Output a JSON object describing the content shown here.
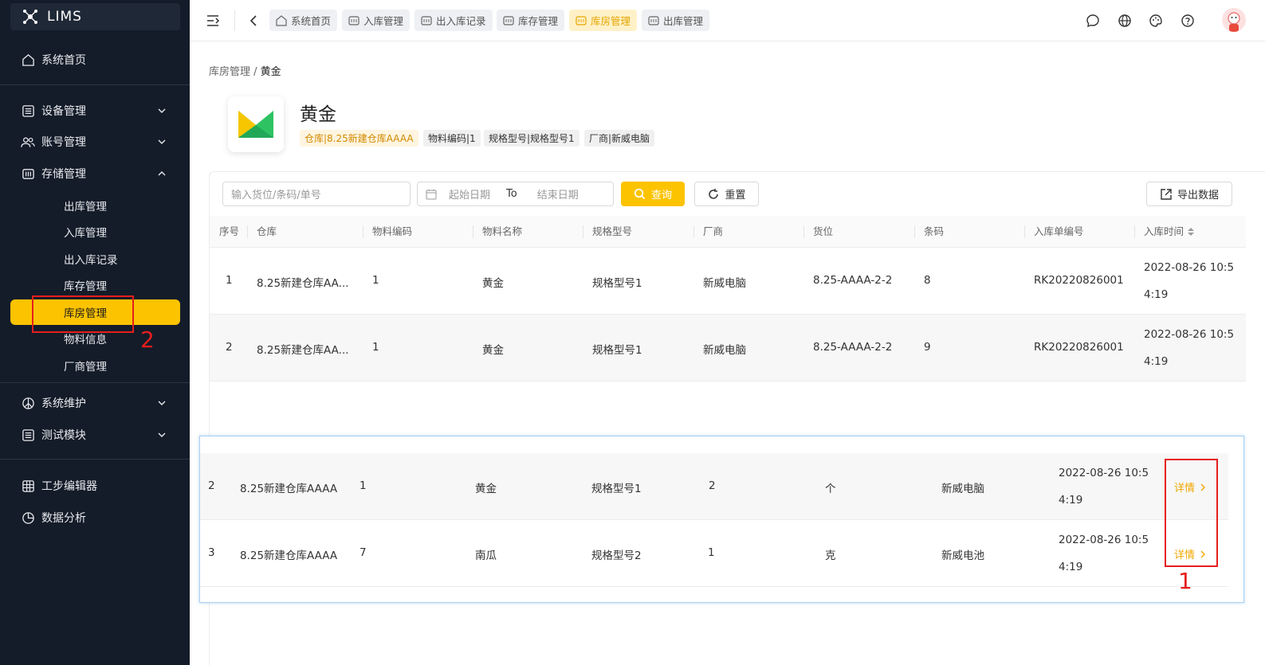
{
  "app": {
    "name": "LIMS"
  },
  "sidebar": {
    "home": "系统首页",
    "groups": [
      {
        "label": "设备管理"
      },
      {
        "label": "账号管理"
      },
      {
        "label": "存储管理"
      }
    ],
    "sub_items": [
      "出库管理",
      "入库管理",
      "出入库记录",
      "库存管理",
      "库房管理",
      "物料信息",
      "厂商管理"
    ],
    "groups2": [
      {
        "label": "系统维护"
      },
      {
        "label": "测试模块"
      }
    ],
    "bottom": [
      "工步编辑器",
      "数据分析"
    ]
  },
  "tabs": [
    "系统首页",
    "入库管理",
    "出入库记录",
    "库存管理",
    "库房管理",
    "出库管理"
  ],
  "breadcrumb": {
    "parent": "库房管理",
    "sep": " / ",
    "current": "黄金"
  },
  "header": {
    "title": "黄金",
    "tags": [
      "仓库|8.25新建仓库AAAA",
      "物料编码|1",
      "规格型号|规格型号1",
      "厂商|新威电脑"
    ]
  },
  "toolbar": {
    "search_placeholder": "输入货位/条码/单号",
    "start_date": "起始日期",
    "to": "To",
    "end_date": "结束日期",
    "query": "查询",
    "reset": "重置",
    "export": "导出数据"
  },
  "table": {
    "headers": [
      "序号",
      "仓库",
      "物料编码",
      "物料名称",
      "规格型号",
      "厂商",
      "货位",
      "条码",
      "入库单编号",
      "入库时间"
    ],
    "rows": [
      {
        "no": "1",
        "warehouse": "8.25新建仓库AA...",
        "code": "1",
        "name": "黄金",
        "spec": "规格型号1",
        "vendor": "新威电脑",
        "slot": "8.25-AAAA-2-2",
        "barcode": "8",
        "order": "RK20220826001",
        "time1": "2022-08-26 10:5",
        "time2": "4:19"
      },
      {
        "no": "2",
        "warehouse": "8.25新建仓库AA...",
        "code": "1",
        "name": "黄金",
        "spec": "规格型号1",
        "vendor": "新威电脑",
        "slot": "8.25-AAAA-2-2",
        "barcode": "9",
        "order": "RK20220826001",
        "time1": "2022-08-26 10:5",
        "time2": "4:19"
      }
    ]
  },
  "overlay": {
    "rows": [
      {
        "no": "2",
        "warehouse": "8.25新建仓库AAAA",
        "code": "1",
        "name": "黄金",
        "spec": "规格型号1",
        "qty": "2",
        "unit": "个",
        "vendor": "新威电脑",
        "time1": "2022-08-26 10:5",
        "time2": "4:19",
        "action": "详情"
      },
      {
        "no": "3",
        "warehouse": "8.25新建仓库AAAA",
        "code": "7",
        "name": "南瓜",
        "spec": "规格型号2",
        "qty": "1",
        "unit": "克",
        "vendor": "新威电池",
        "time1": "2022-08-26 10:5",
        "time2": "4:19",
        "action": "详情"
      }
    ]
  },
  "annotations": {
    "one": "1",
    "two": "2"
  },
  "colors": {
    "accent": "#fcc300",
    "sidebar": "#141c29",
    "annotation": "#e61e1e"
  }
}
